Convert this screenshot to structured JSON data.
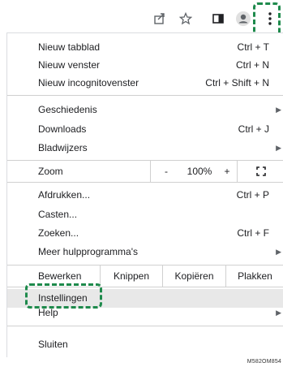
{
  "toolbar": {
    "icons": [
      "share-icon",
      "star-icon",
      "sidebar-icon",
      "profile-icon",
      "more-vert-icon"
    ]
  },
  "menu": {
    "new_tab": {
      "label": "Nieuw tabblad",
      "shortcut": "Ctrl + T"
    },
    "new_window": {
      "label": "Nieuw venster",
      "shortcut": "Ctrl + N"
    },
    "new_incognito": {
      "label": "Nieuw incognitovenster",
      "shortcut": "Ctrl + Shift + N"
    },
    "history": {
      "label": "Geschiedenis"
    },
    "downloads": {
      "label": "Downloads",
      "shortcut": "Ctrl + J"
    },
    "bookmarks": {
      "label": "Bladwijzers"
    },
    "zoom": {
      "label": "Zoom",
      "minus": "-",
      "value": "100%",
      "plus": "+"
    },
    "print": {
      "label": "Afdrukken...",
      "shortcut": "Ctrl + P"
    },
    "cast": {
      "label": "Casten..."
    },
    "find": {
      "label": "Zoeken...",
      "shortcut": "Ctrl + F"
    },
    "more_tools": {
      "label": "Meer hulpprogramma's"
    },
    "edit": {
      "label": "Bewerken",
      "cut": "Knippen",
      "copy": "Kopiëren",
      "paste": "Plakken"
    },
    "settings": {
      "label": "Instellingen"
    },
    "help": {
      "label": "Help"
    },
    "exit": {
      "label": "Sluiten"
    }
  },
  "caption": "M582OM854",
  "colors": {
    "highlight_box": "#1e8a4c",
    "hover": "#e8e8e8",
    "separator": "#d0d0d0"
  }
}
